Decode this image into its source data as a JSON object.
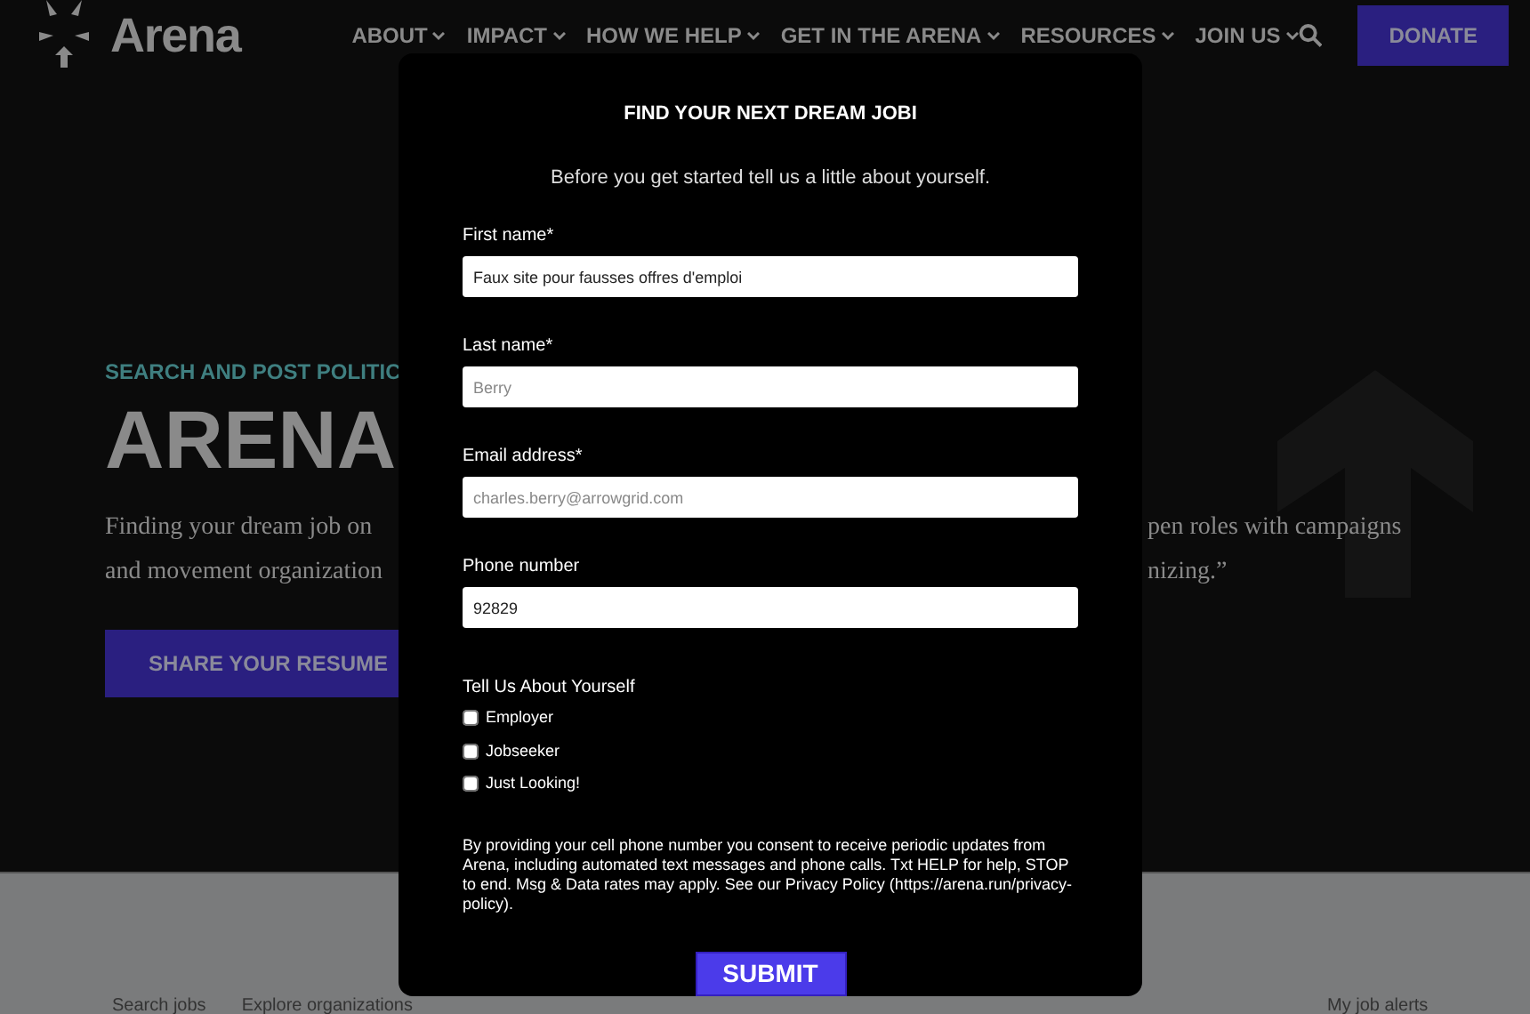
{
  "header": {
    "logo": "Arena",
    "nav": [
      {
        "label": "ABOUT"
      },
      {
        "label": "IMPACT"
      },
      {
        "label": "HOW WE HELP"
      },
      {
        "label": "GET IN THE ARENA"
      },
      {
        "label": "RESOURCES"
      },
      {
        "label": "JOIN US"
      }
    ],
    "donate": "DONATE"
  },
  "hero": {
    "eyebrow": "SEARCH AND POST POLITIC",
    "title": "ARENA",
    "left_lines": [
      "Finding your dream job on",
      "and movement organization"
    ],
    "right_lines": [
      "pen roles with campaigns",
      "nizing.”"
    ],
    "button": "SHARE YOUR RESUME"
  },
  "footer_links": [
    "Search jobs",
    "Explore organizations",
    "My job alerts"
  ],
  "modal": {
    "title": "FIND YOUR NEXT DREAM JOBI",
    "subtitle": "Before you get started tell us a little about yourself.",
    "fields": [
      {
        "label": "First name*",
        "value": "Faux site pour fausses offres d'emploi"
      },
      {
        "label": "Last name*",
        "placeholder": "Berry"
      },
      {
        "label": "Email address*",
        "placeholder": "charles.berry@arrowgrid.com"
      },
      {
        "label": "Phone number",
        "value": "92829"
      }
    ],
    "group_label": "Tell Us About Yourself",
    "options": [
      {
        "label": "Employer",
        "checked": false
      },
      {
        "label": "Jobseeker",
        "checked": false
      },
      {
        "label": "Just Looking!",
        "checked": false
      }
    ],
    "consent": "By providing your cell phone number you consent to receive periodic updates from Arena, including automated text messages and phone calls. Txt HELP for help, STOP to end. Msg & Data rates may apply. See our Privacy Policy (https://arena.run/privacy-policy).",
    "submit": "SUBMIT"
  }
}
